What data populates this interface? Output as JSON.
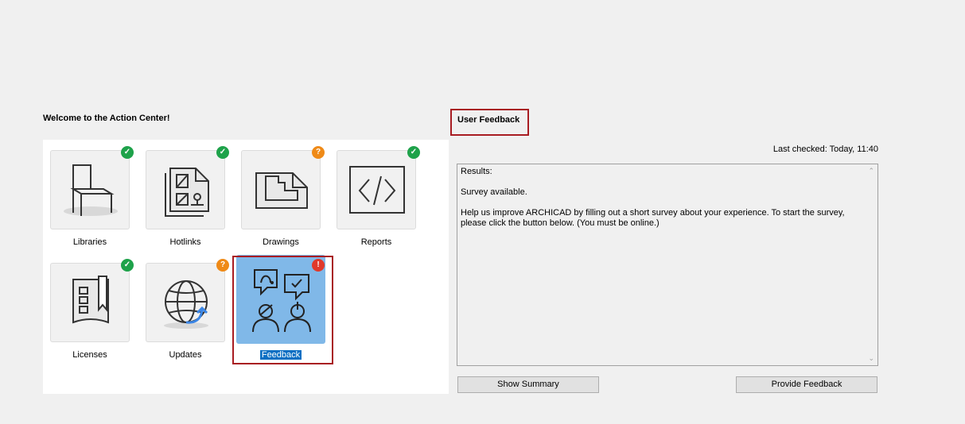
{
  "left_panel": {
    "title": "Welcome to the Action Center!",
    "tiles": [
      {
        "label": "Libraries",
        "icon": "chair-icon",
        "status": "ok"
      },
      {
        "label": "Hotlinks",
        "icon": "hotlinks-icon",
        "status": "ok"
      },
      {
        "label": "Drawings",
        "icon": "drawings-icon",
        "status": "question"
      },
      {
        "label": "Reports",
        "icon": "code-icon",
        "status": "ok"
      },
      {
        "label": "Licenses",
        "icon": "license-icon",
        "status": "ok"
      },
      {
        "label": "Updates",
        "icon": "globe-update-icon",
        "status": "question"
      },
      {
        "label": "Feedback",
        "icon": "feedback-people-icon",
        "status": "error",
        "selected": true
      }
    ]
  },
  "right_panel": {
    "title": "User Feedback",
    "last_checked": "Last checked: Today, 11:40",
    "results_heading": "Results:",
    "results_status": "Survey available.",
    "results_body": "Help us improve ARCHICAD by filling out a short survey about your experience. To start the survey, please click the button below. (You must be online.)",
    "buttons": {
      "show_summary": "Show Summary",
      "provide_feedback": "Provide Feedback"
    }
  },
  "badges": {
    "ok": "✓",
    "question": "?",
    "error": "!"
  },
  "colors": {
    "ok": "#1ea24a",
    "question": "#ef8a17",
    "error": "#e0392b",
    "highlight_frame": "#a81c22",
    "selection": "#80b8e8"
  }
}
